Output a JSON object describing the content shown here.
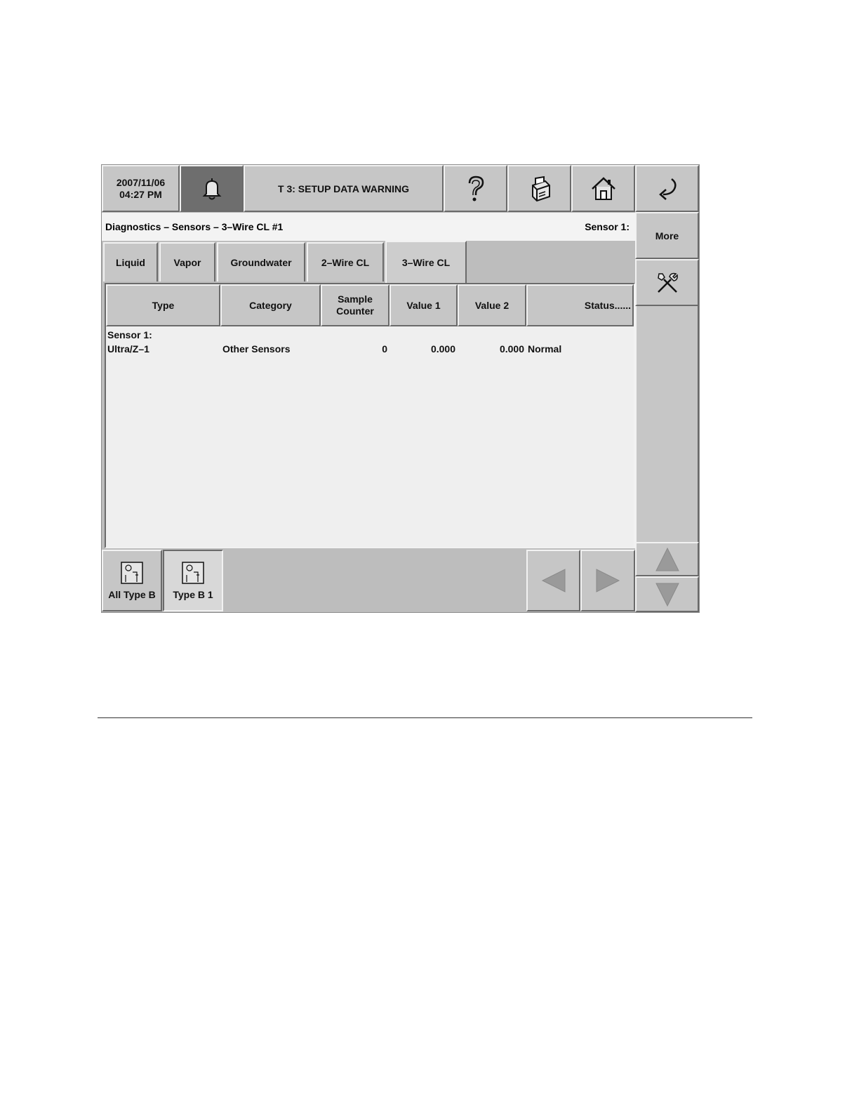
{
  "header": {
    "date": "2007/11/06",
    "time": "04:27 PM",
    "alarm_message": "T 3: SETUP DATA WARNING",
    "icons": [
      "bell-icon",
      "help-icon",
      "printer-icon",
      "home-icon",
      "back-icon"
    ]
  },
  "status": {
    "breadcrumb": "Diagnostics – Sensors – 3–Wire CL #1",
    "sensor_label": "Sensor 1:"
  },
  "side": {
    "more_label": "More",
    "tools_icon": "tools-icon"
  },
  "tabs": [
    {
      "label": "Liquid",
      "active": false
    },
    {
      "label": "Vapor",
      "active": false
    },
    {
      "label": "Groundwater",
      "active": false
    },
    {
      "label": "2–Wire CL",
      "active": false
    },
    {
      "label": "3–Wire CL",
      "active": true
    }
  ],
  "table": {
    "columns": [
      "Type",
      "Category",
      "Sample Counter",
      "Value 1",
      "Value 2",
      "Status......"
    ],
    "group_label": "Sensor 1:",
    "rows": [
      {
        "type": "Ultra/Z–1",
        "category": "Other Sensors",
        "sample_counter": "0",
        "value1": "0.000",
        "value2": "0.000",
        "status": "Normal"
      }
    ]
  },
  "bottom": {
    "buttons": [
      {
        "label": "All Type B",
        "icon": "panel-icon"
      },
      {
        "label": "Type B 1",
        "icon": "panel-icon"
      }
    ],
    "nav_icons": [
      "arrow-left-icon",
      "arrow-right-icon",
      "arrow-up-icon",
      "arrow-down-icon"
    ]
  },
  "colors": {
    "panel": "#bdbdbd",
    "button": "#c6c6c6",
    "bell_button": "#6e6e6e",
    "table_bg": "#efefef"
  }
}
